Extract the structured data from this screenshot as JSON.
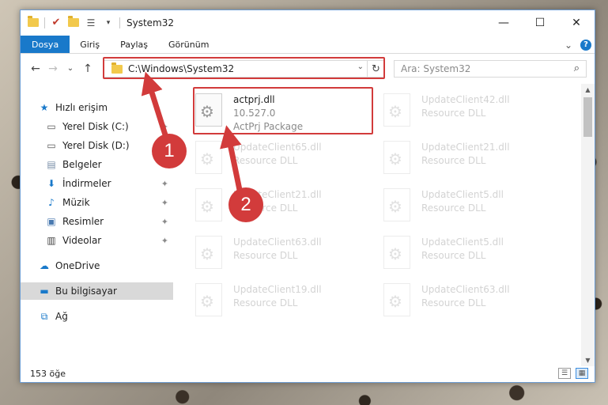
{
  "window": {
    "title": "System32",
    "controls": {
      "minimize": "—",
      "maximize": "☐",
      "close": "✕"
    }
  },
  "ribbon": {
    "tabs": [
      "Dosya",
      "Giriş",
      "Paylaş",
      "Görünüm"
    ],
    "collapse_icon": "⌄",
    "help_icon": "?"
  },
  "nav": {
    "back": "←",
    "forward": "→",
    "recent": "⌄",
    "up": "↑"
  },
  "address": {
    "path": "C:\\Windows\\System32",
    "dropdown": "⌄",
    "refresh": "↻"
  },
  "search": {
    "placeholder": "Ara: System32",
    "icon": "⌕"
  },
  "sidebar": {
    "items": [
      {
        "label": "Hızlı erişim",
        "icon": "star-icon",
        "glyph": "★",
        "pinned": false
      },
      {
        "label": "Yerel Disk (C:)",
        "icon": "drive-icon",
        "glyph": "▭",
        "pinned": true
      },
      {
        "label": "Yerel Disk (D:)",
        "icon": "drive-icon",
        "glyph": "▭",
        "pinned": true
      },
      {
        "label": "Belgeler",
        "icon": "documents-icon",
        "glyph": "▤",
        "pinned": true
      },
      {
        "label": "İndirmeler",
        "icon": "downloads-icon",
        "glyph": "⬇",
        "pinned": true
      },
      {
        "label": "Müzik",
        "icon": "music-icon",
        "glyph": "♪",
        "pinned": true
      },
      {
        "label": "Resimler",
        "icon": "pictures-icon",
        "glyph": "▣",
        "pinned": true
      },
      {
        "label": "Videolar",
        "icon": "videos-icon",
        "glyph": "▥",
        "pinned": true
      },
      {
        "label": "OneDrive",
        "icon": "cloud-icon",
        "glyph": "☁",
        "pinned": false
      },
      {
        "label": "Bu bilgisayar",
        "icon": "computer-icon",
        "glyph": "▬",
        "pinned": false,
        "selected": true
      },
      {
        "label": "Ağ",
        "icon": "network-icon",
        "glyph": "⧉",
        "pinned": false
      }
    ],
    "pin_glyph": "✦"
  },
  "files": [
    {
      "name": "actprj.dll",
      "version": "10.527.0",
      "desc": "ActPrj Package",
      "highlighted": true
    },
    {
      "name": "UpdateClient42.dll",
      "version": "",
      "desc": "Resource DLL"
    },
    {
      "name": "UpdateClient65.dll",
      "version": "",
      "desc": "Resource DLL"
    },
    {
      "name": "UpdateClient21.dll",
      "version": "",
      "desc": "Resource DLL"
    },
    {
      "name": "UpdateClient21.dll",
      "version": "",
      "desc": "Resource DLL"
    },
    {
      "name": "UpdateClient5.dll",
      "version": "",
      "desc": "Resource DLL"
    },
    {
      "name": "UpdateClient63.dll",
      "version": "",
      "desc": "Resource DLL"
    },
    {
      "name": "UpdateClient5.dll",
      "version": "",
      "desc": "Resource DLL"
    },
    {
      "name": "UpdateClient19.dll",
      "version": "",
      "desc": "Resource DLL"
    },
    {
      "name": "UpdateClient63.dll",
      "version": "",
      "desc": "Resource DLL"
    }
  ],
  "status": {
    "count": "153 öğe"
  },
  "annotations": {
    "step1": "1",
    "step2": "2",
    "color": "#d23b3b"
  },
  "colors": {
    "accent": "#1979ca",
    "selection": "#cce1f5"
  }
}
